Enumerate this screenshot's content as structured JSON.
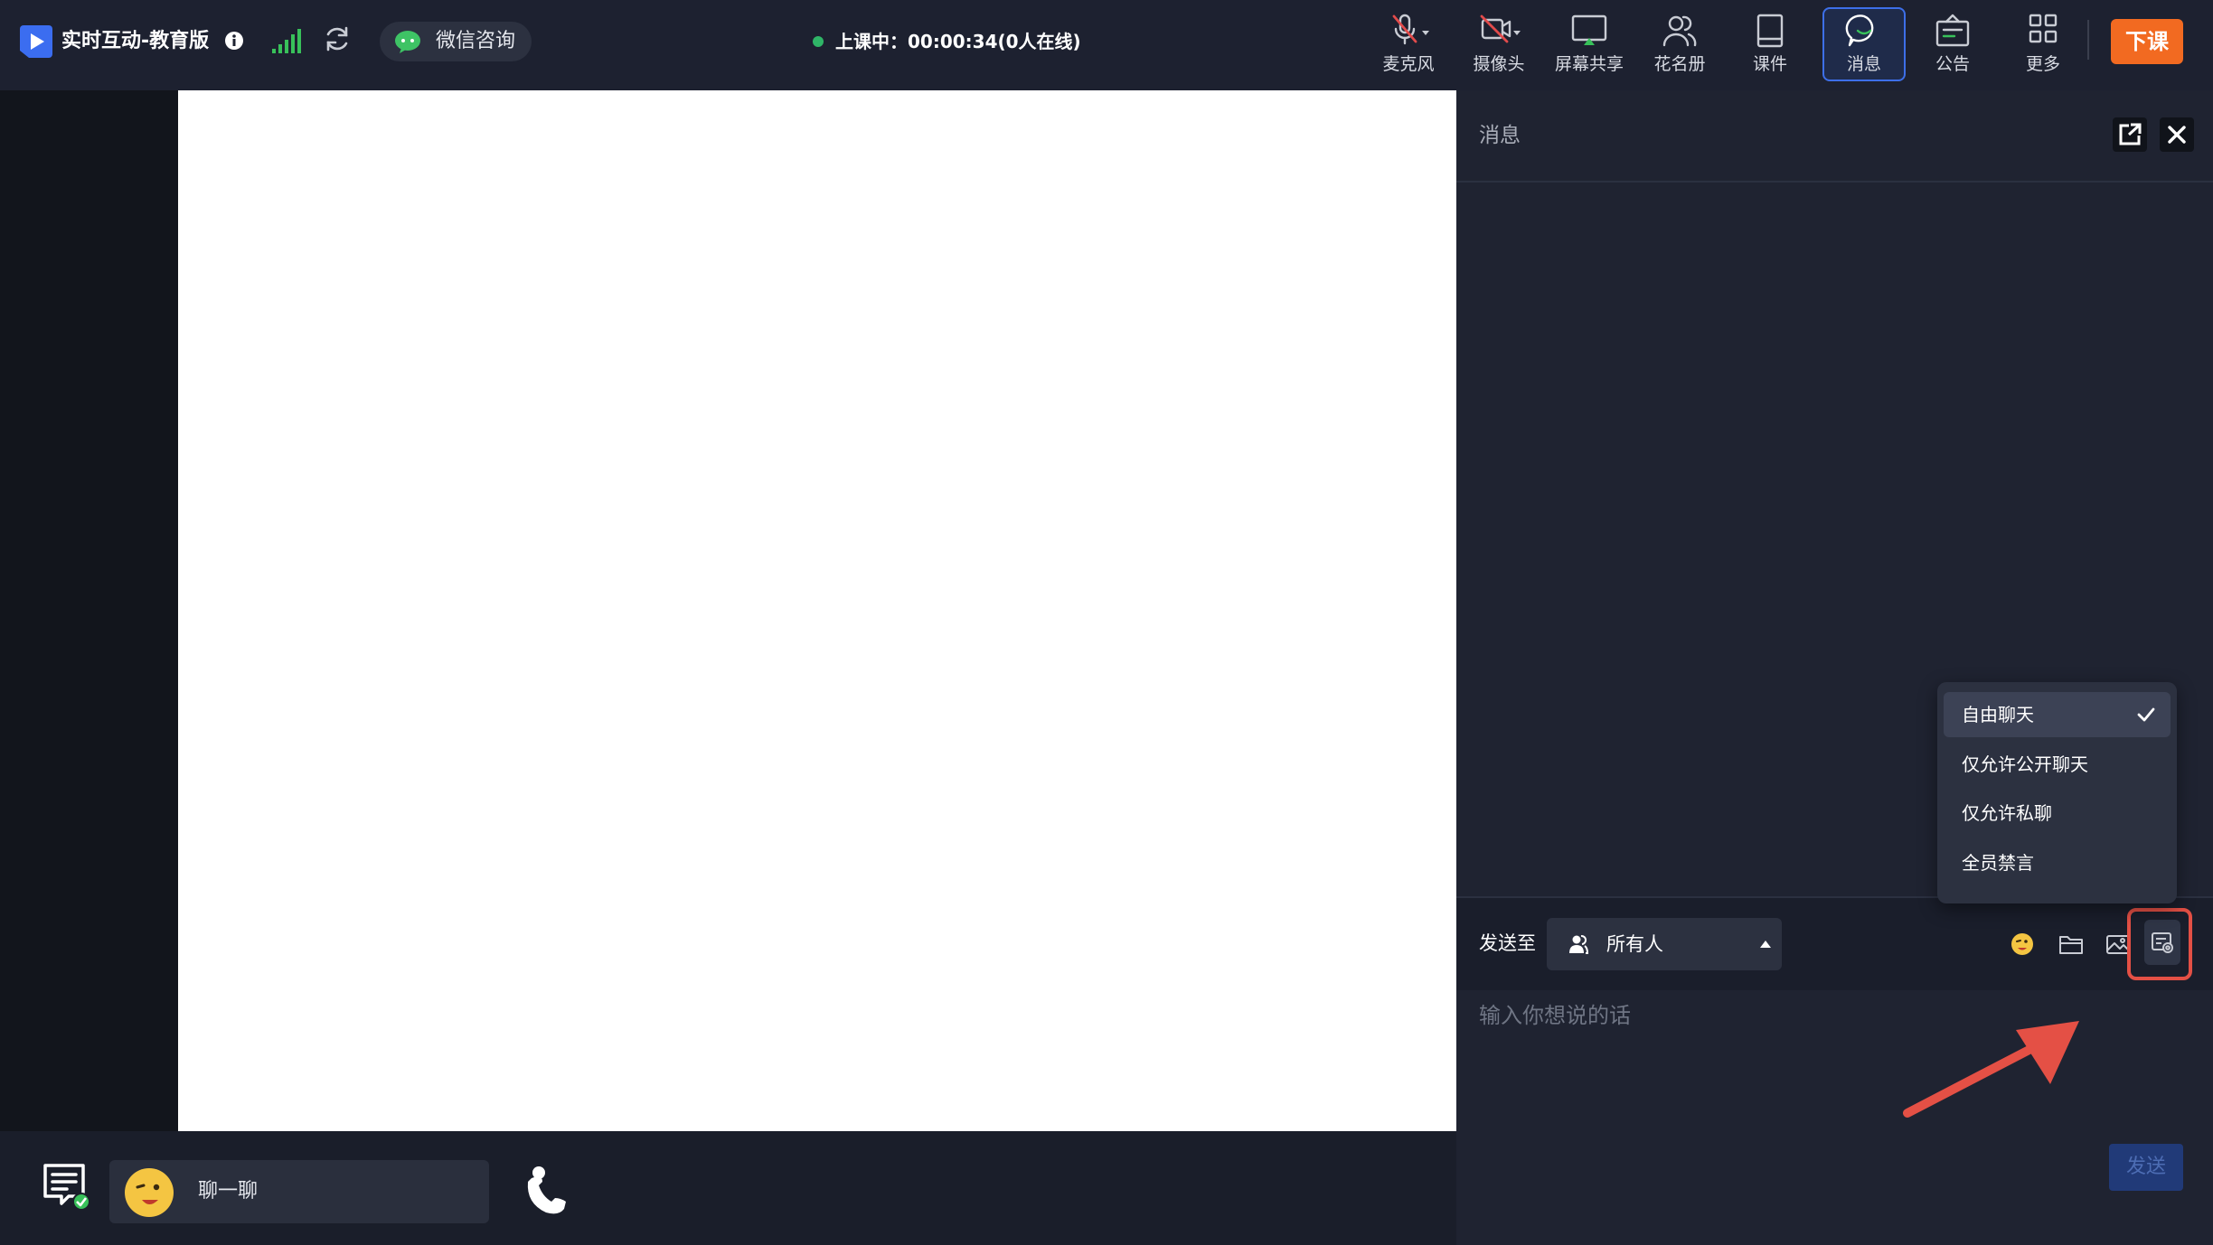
{
  "header": {
    "app_title": "实时互动-教育版",
    "wechat_label": "微信咨询",
    "status_text": "上课中：00:00:34(0人在线)",
    "tools": [
      {
        "label": "麦克风",
        "icon": "mic-off-icon"
      },
      {
        "label": "摄像头",
        "icon": "camera-off-icon"
      },
      {
        "label": "屏幕共享",
        "icon": "screen-share-icon"
      },
      {
        "label": "花名册",
        "icon": "roster-icon"
      },
      {
        "label": "课件",
        "icon": "courseware-icon"
      },
      {
        "label": "消息",
        "icon": "message-icon",
        "active": true
      },
      {
        "label": "公告",
        "icon": "announcement-icon"
      },
      {
        "label": "更多",
        "icon": "more-grid-icon"
      }
    ],
    "end_class_label": "下课"
  },
  "bottom_bar": {
    "chat_label": "聊一聊"
  },
  "message_panel": {
    "title": "消息",
    "send_to_label": "发送至",
    "recipient": "所有人",
    "input_placeholder": "输入你想说的话",
    "send_label": "发送",
    "chat_mode_menu": {
      "options": [
        "自由聊天",
        "仅允许公开聊天",
        "仅允许私聊",
        "全员禁言"
      ],
      "selected": "自由聊天"
    }
  },
  "colors": {
    "accent_orange": "#f26a21",
    "active_blue": "#3d6fe8",
    "online_green": "#2fb567",
    "highlight_red": "#e45045",
    "panel_bg": "#1f2331",
    "topbar_bg": "#1d2130"
  }
}
